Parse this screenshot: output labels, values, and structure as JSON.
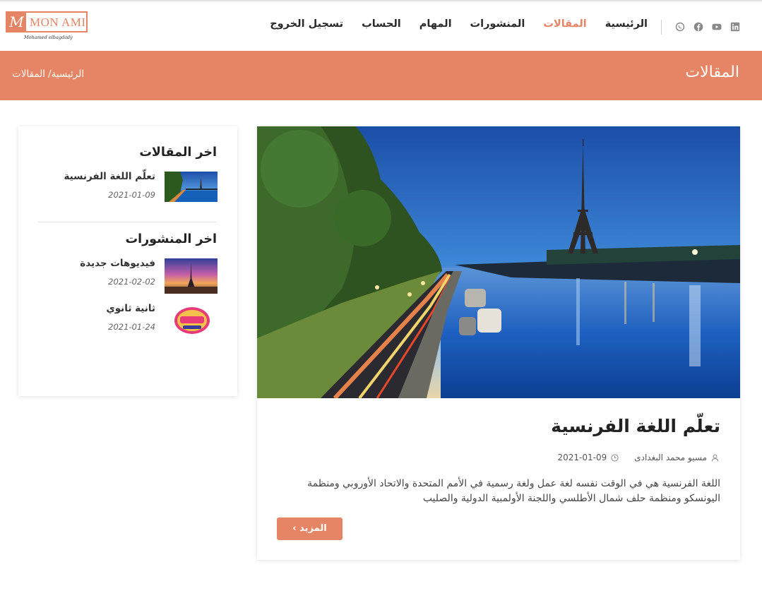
{
  "logo": {
    "mark": "M",
    "name": "MON AMI",
    "tagline": "Mohamed elbagdady"
  },
  "nav": {
    "items": [
      {
        "label": "الرئيسية",
        "active": false
      },
      {
        "label": "المقالات",
        "active": true
      },
      {
        "label": "المنشورات",
        "active": false
      },
      {
        "label": "المهام",
        "active": false
      },
      {
        "label": "الحساب",
        "active": false
      },
      {
        "label": "تسجيل الخروج",
        "active": false
      }
    ],
    "social_icons": [
      "linkedin-icon",
      "youtube-icon",
      "facebook-icon",
      "whatsapp-icon"
    ]
  },
  "banner": {
    "title": "المقالات",
    "breadcrumb_home": "الرئيسية/",
    "breadcrumb_current": "المقالات"
  },
  "sidebar": {
    "latest_articles_heading": "اخر المقالات",
    "latest_articles": [
      {
        "title": "تعلّم اللغة الفرنسية",
        "date": "2021-01-09"
      }
    ],
    "latest_posts_heading": "اخر المنشورات",
    "latest_posts": [
      {
        "title": "فيديوهات جديدة",
        "date": "2021-02-02"
      },
      {
        "title": "ثانية ثانوي",
        "date": "2021-01-24"
      }
    ]
  },
  "article": {
    "title": "تعلّم اللغة الفرنسية",
    "author": "مسيو محمد البغدادى",
    "date": "2021-01-09",
    "excerpt": "اللغة الفرنسية هي في الوقت نفسه لغة عمل ولغة رسمية في الأمم المتحدة والاتحاد الأوروبي ومنظمة اليونسكو ومنظمة حلف شمال الأطلسي واللجنة الأولمبية الدولية والصليب",
    "more_label": "المزيد",
    "more_icon": "›"
  },
  "colors": {
    "accent": "#e58565",
    "text": "#222222"
  }
}
